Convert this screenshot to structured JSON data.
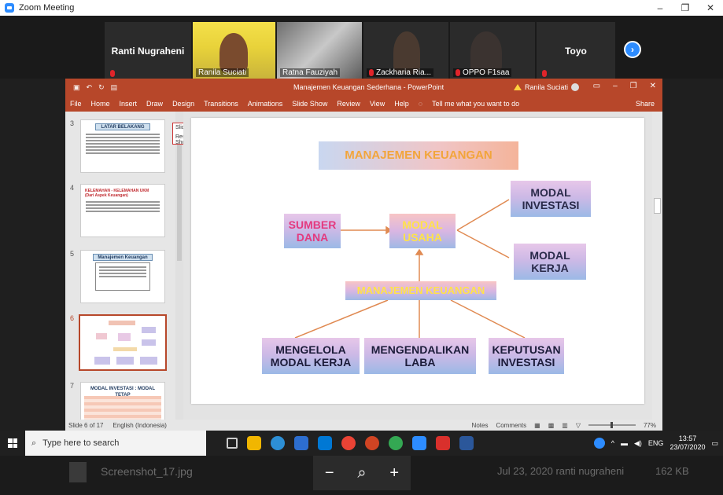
{
  "window": {
    "title": "Zoom Meeting",
    "controls": [
      "–",
      "❐",
      "✕"
    ]
  },
  "gallery": {
    "tiles": [
      {
        "id": "ranti-nugraheni",
        "label": "Ranti Nugraheni",
        "muted": true
      },
      {
        "id": "ranila-suciati",
        "label": "Ranila Suciati",
        "muted": false
      },
      {
        "id": "ratna-fauziyah",
        "label": "Ratna Fauziyah",
        "muted": false
      },
      {
        "id": "zackharia",
        "label": "Zackharia Ria...",
        "muted": true
      },
      {
        "id": "oppo",
        "label": "OPPO F1saa",
        "muted": true
      },
      {
        "id": "toyo",
        "label": "Toyo",
        "muted": true
      }
    ],
    "next_label": "›"
  },
  "ppt": {
    "doc_title": "Manajemen Keuangan Sederhana - PowerPoint",
    "user": "Ranila Suciati",
    "menu": [
      "File",
      "Home",
      "Insert",
      "Draw",
      "Design",
      "Transitions",
      "Animations",
      "Slide Show",
      "Review",
      "View",
      "Help"
    ],
    "tell_me": "Tell me what you want to do",
    "share": "Share",
    "slideshow_popup": {
      "title": "Slide Show",
      "resume": "Resume Slide Show"
    },
    "thumbs": [
      {
        "num": "3",
        "title": "LATAR BELAKANG"
      },
      {
        "num": "4",
        "title": "KELEMAHAN - KELEMAHAN UKM",
        "subtitle": "(Dari Aspek Keuangan)"
      },
      {
        "num": "5",
        "title": "Manajemen Keuangan"
      },
      {
        "num": "6",
        "title": ""
      },
      {
        "num": "7",
        "title": "MODAL INVESTASI : MODAL TETAP"
      }
    ],
    "slide": {
      "title": "MANAJEMEN KEUANGAN",
      "sumber": "SUMBER DANA",
      "modal_usaha": "MODAL USAHA",
      "modal_investasi": "MODAL INVESTASI",
      "modal_kerja": "MODAL KERJA",
      "manajemen": "MANAJEMEN KEUANGAN",
      "mengelola": "MENGELOLA MODAL KERJA",
      "mengendalikan": "MENGENDALIKAN LABA",
      "keputusan": "KEPUTUSAN INVESTASI"
    },
    "status": {
      "slide": "Slide 6 of 17",
      "language": "English (Indonesia)",
      "notes": "Notes",
      "comments": "Comments",
      "zoom": "77%"
    }
  },
  "taskbar": {
    "search_placeholder": "Type here to search",
    "time": "13:57",
    "date": "23/07/2020",
    "lang": "ENG"
  },
  "viewer": {
    "filename": "Screenshot_17.jpg",
    "date": "Jul 23, 2020",
    "owner": "ranti nugraheni",
    "size": "162 KB"
  },
  "colors": {
    "accent": "#2d8cff",
    "ppt": "#b7472a",
    "muted": "#e0242a"
  }
}
